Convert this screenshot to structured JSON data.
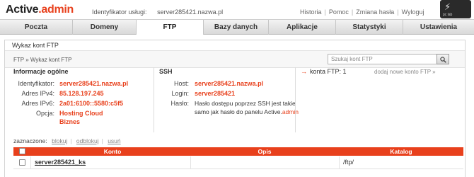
{
  "header": {
    "logo_main": "Active",
    "logo_dot": ".",
    "logo_accent": "admin",
    "ident_label": "Identyfikator usługi:",
    "ident_value": "server285421.nazwa.pl",
    "links": [
      "Historia",
      "Pomoc",
      "Zmiana hasła",
      "Wyloguj"
    ],
    "badge_text": "pc lab"
  },
  "tabs": [
    "Poczta",
    "Domeny",
    "FTP",
    "Bazy danych",
    "Aplikacje",
    "Statystyki",
    "Ustawienia"
  ],
  "active_tab": "FTP",
  "panel": {
    "title": "Wykaz kont FTP",
    "breadcrumb_root": "FTP",
    "breadcrumb_sep": "»",
    "breadcrumb_current": "Wykaz kont FTP",
    "search_placeholder": "Szukaj kont FTP"
  },
  "general": {
    "title": "Informacje ogólne",
    "rows": [
      {
        "label": "Identyfikator:",
        "value": "server285421.nazwa.pl"
      },
      {
        "label": "Adres IPv4:",
        "value": "85.128.197.245"
      },
      {
        "label": "Adres IPv6:",
        "value": "2a01:6100::5580:c5f5"
      },
      {
        "label": "Opcja:",
        "value": "Hosting Cloud",
        "value2": "Biznes"
      }
    ]
  },
  "ssh": {
    "title": "SSH",
    "host_label": "Host:",
    "host_value": "server285421.nazwa.pl",
    "login_label": "Login:",
    "login_value": "server285421",
    "pass_label": "Hasło:",
    "pass_line1": "Hasło dostępu poprzez SSH jest takie",
    "pass_line2": "samo jak hasło do panelu Active.",
    "pass_accent": "admin"
  },
  "side": {
    "arrow": "→",
    "counter": "konta FTP: 1",
    "add_link": "dodaj nowe konto FTP »"
  },
  "actions": {
    "label": "zaznaczone:",
    "items": [
      "blokuj",
      "odblokuj",
      "usuń"
    ],
    "sep": "|"
  },
  "table": {
    "columns": [
      "Konto",
      "Opis",
      "Katalog"
    ],
    "rows": [
      {
        "account": "server285421_ks",
        "description": "",
        "directory": "/ftp/"
      }
    ]
  }
}
